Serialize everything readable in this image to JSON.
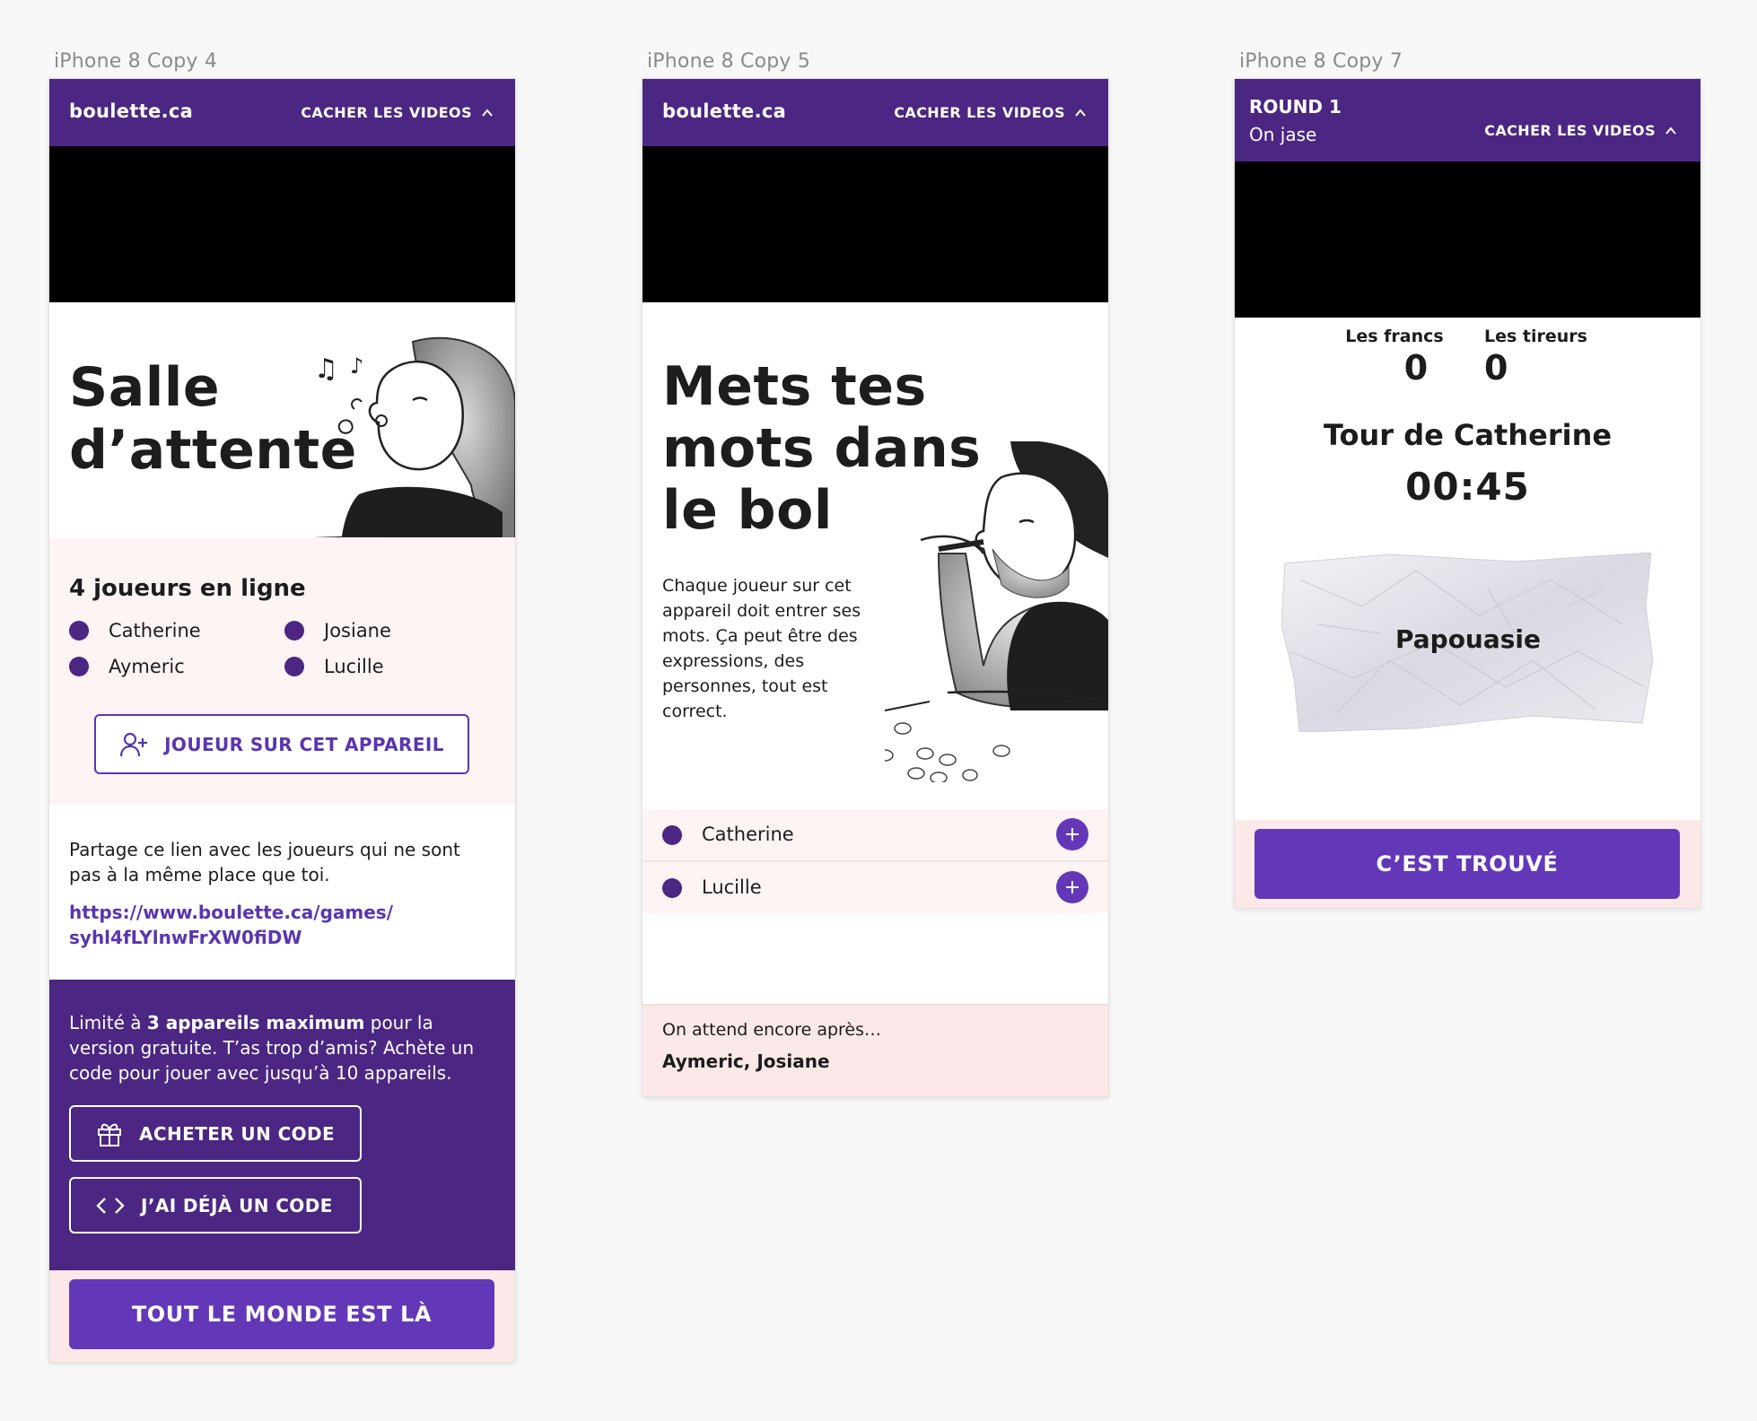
{
  "artboards": [
    "iPhone 8 Copy 4",
    "iPhone 8 Copy 5",
    "iPhone 8 Copy 7"
  ],
  "colors": {
    "brand_purple": "#4b2682",
    "button_purple": "#6338b8",
    "pink_bg": "#fff4f4",
    "footer_pink": "#fbe8e8"
  },
  "header": {
    "brand": "boulette.ca",
    "hide_videos": "CACHER LES VIDEOS",
    "chevron_icon": "chevron-up-icon"
  },
  "screen1": {
    "title_line1": "Salle",
    "title_line2": "d’attente",
    "online_heading": "4 joueurs en ligne",
    "players": [
      "Catherine",
      "Josiane",
      "Aymeric",
      "Lucille"
    ],
    "add_player_button": "JOUEUR SUR CET APPAREIL",
    "share_text": "Partage ce lien avec les joueurs qui ne sont pas à la même place que toi.",
    "share_link_line1": "https://www.boulette.ca/games/",
    "share_link_line2": "syhl4fLYlnwFrXW0fiDW",
    "limit_text_before": "Limité à ",
    "limit_text_bold": "3 appareils maximum",
    "limit_text_after": " pour la version gratuite. T’as trop d’amis? Achète un code pour jouer avec jusqu’à 10 appareils.",
    "buy_code_button": "ACHETER UN CODE",
    "have_code_button": "J’AI DÉJÀ UN CODE",
    "everyone_here_button": "TOUT LE MONDE EST LÀ"
  },
  "screen2": {
    "title_line1": "Mets tes",
    "title_line2": "mots dans",
    "title_line3": "le bol",
    "description": "Chaque joueur sur cet appareil doit entrer ses mots. Ça peut être des expressions, des personnes, tout est correct.",
    "players": [
      "Catherine",
      "Lucille"
    ],
    "waiting_label": "On attend encore après…",
    "waiting_names": "Aymeric, Josiane"
  },
  "screen3": {
    "round_label": "ROUND 1",
    "round_name": "On jase",
    "team1_name": "Les francs",
    "team1_score": "0",
    "team2_name": "Les tireurs",
    "team2_score": "0",
    "turn_label": "Tour de Catherine",
    "timer": "00:45",
    "word": "Papouasie",
    "found_button": "C’EST TROUVÉ"
  }
}
